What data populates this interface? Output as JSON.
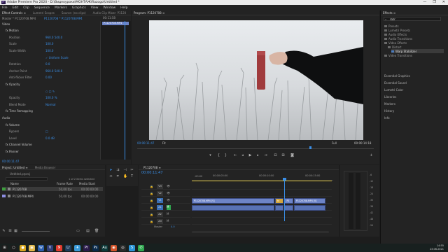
{
  "window": {
    "title": "Adobe Premiere Pro 2020 - D:\\Видеоуроки\\МОНТАЖ\\Razogo\\Untitled *",
    "controls": [
      "—",
      "❐",
      "✕"
    ]
  },
  "menu": [
    "File",
    "Edit",
    "Clip",
    "Sequence",
    "Markers",
    "Graphics",
    "View",
    "Window",
    "Help"
  ],
  "source_tabs": [
    "Effect Controls ≡",
    "Lumetri Scopes",
    "Source: (no clips)",
    "Audio Clip Mixer: P1120"
  ],
  "effect_controls": {
    "source": "Master * P1120708.MP4",
    "sequence": "P1120708 * P1120708.MP4",
    "timecode": "00:11:58",
    "clip": "P1120708.MP4",
    "rows": [
      {
        "label": "Video",
        "val": "",
        "indent": 0
      },
      {
        "label": "fx Motion",
        "val": "",
        "indent": 1
      },
      {
        "label": "Position",
        "val": "960.0    540.0",
        "indent": 2
      },
      {
        "label": "Scale",
        "val": "100.0",
        "indent": 2
      },
      {
        "label": "Scale Width",
        "val": "100.0",
        "indent": 2
      },
      {
        "label": "",
        "val": "✓ Uniform Scale",
        "indent": 2
      },
      {
        "label": "Rotation",
        "val": "0.0",
        "indent": 2
      },
      {
        "label": "Anchor Point",
        "val": "960.0    540.0",
        "indent": 2
      },
      {
        "label": "Anti-flicker Filter",
        "val": "0.00",
        "indent": 2
      },
      {
        "label": "fx Opacity",
        "val": "",
        "indent": 1
      },
      {
        "label": "",
        "val": "○ □ ✎",
        "indent": 2
      },
      {
        "label": "Opacity",
        "val": "100.0 %",
        "indent": 2
      },
      {
        "label": "Blend Mode",
        "val": "Normal",
        "indent": 2
      },
      {
        "label": "fx Time Remapping",
        "val": "",
        "indent": 1
      },
      {
        "label": "Audio",
        "val": "",
        "indent": 0
      },
      {
        "label": "fx Volume",
        "val": "",
        "indent": 1
      },
      {
        "label": "Bypass",
        "val": "□",
        "indent": 2
      },
      {
        "label": "Level",
        "val": "0.0 dB",
        "indent": 2
      },
      {
        "label": "fx Channel Volume",
        "val": "",
        "indent": 1
      },
      {
        "label": "fx Panner",
        "val": "",
        "indent": 1
      }
    ],
    "footer": "00:00:11:47"
  },
  "program": {
    "tab": "Program: P1120708 ≡",
    "timecode": "00:00:11:47",
    "fit": "Fit",
    "quality": "Full",
    "duration": "00:00:14:18"
  },
  "project": {
    "tabs": [
      "Project: Untitled ≡",
      "Media Browser"
    ],
    "name": "Untitled.prproj",
    "count": "1 of 2 items selected",
    "headers": [
      "Name",
      "Frame Rate",
      "Media Start"
    ],
    "items": [
      {
        "name": "P1120708",
        "rate": "50,00 fps",
        "start": "00:00:00:00",
        "color": "#3c9e3c"
      },
      {
        "name": "P1120708.MP4",
        "rate": "50,00 fps",
        "start": "00:00:00:00",
        "color": "#8d8de0"
      }
    ]
  },
  "timeline": {
    "tab": "P1120708 ≡",
    "timecode": "00:00:11:47",
    "ruler": [
      "00:00:05:00",
      "00:00:10:00",
      "00:00:15:00"
    ],
    "ruler_start": ":00:00",
    "video_tracks": [
      "V3",
      "V2",
      "V1"
    ],
    "audio_tracks": [
      "A1",
      "A2",
      "A3"
    ],
    "master": "Master",
    "master_val": "0.0",
    "clip_name": "P1120708.MP4 [V]",
    "clip_short": "P11",
    "clips_v1": [
      {
        "label": "P1120708.MP4 [V]",
        "start": 0.0,
        "end": 0.62
      },
      {
        "label": "fx",
        "start": 0.62,
        "end": 0.69
      },
      {
        "label": "P1",
        "start": 0.69,
        "end": 0.76
      },
      {
        "label": "P1120708.MP4 [V]",
        "start": 0.76,
        "end": 1.0
      }
    ],
    "playhead": 0.69,
    "audio_db": [
      "-6",
      "-12",
      "-18",
      "-24",
      "-30",
      "-36",
      "-42",
      "-48",
      "-54"
    ]
  },
  "effects": {
    "tab": "Effects ≡",
    "search": "razr",
    "tree": [
      {
        "label": "Presets",
        "indent": 0,
        "folder": true
      },
      {
        "label": "Lumetri Presets",
        "indent": 0,
        "folder": true
      },
      {
        "label": "Audio Effects",
        "indent": 0,
        "folder": true
      },
      {
        "label": "Audio Transitions",
        "indent": 0,
        "folder": true
      },
      {
        "label": "Video Effects",
        "indent": 0,
        "folder": true
      },
      {
        "label": "Distort",
        "indent": 1,
        "folder": true
      },
      {
        "label": "Warp Stabilizer",
        "indent": 2,
        "folder": false,
        "selected": true
      },
      {
        "label": "Video Transitions",
        "indent": 0,
        "folder": true
      }
    ],
    "sections": [
      "Essential Graphics",
      "Essential Sound",
      "Lumetri Color",
      "Libraries",
      "Markers",
      "History",
      "Info"
    ]
  },
  "taskbar": {
    "time": "14:55",
    "date": "23.06.2021",
    "icons": [
      {
        "name": "windows-start-icon",
        "glyph": "⊞",
        "color": "#1d1d1d"
      },
      {
        "name": "search-taskbar-icon",
        "glyph": "○",
        "color": "#1d1d1d"
      },
      {
        "name": "chrome-icon",
        "glyph": "●",
        "color": "#d7a520"
      },
      {
        "name": "explorer-icon",
        "glyph": "▣",
        "color": "#e3b84a"
      },
      {
        "name": "word-icon",
        "glyph": "W",
        "color": "#2b5fb0"
      },
      {
        "name": "vegas-icon",
        "glyph": "V",
        "color": "#2f3f7a"
      },
      {
        "name": "yandex-icon",
        "glyph": "Я",
        "color": "#e23b2e"
      },
      {
        "name": "lightroom-icon",
        "glyph": "Lr",
        "color": "#1d3b5a"
      },
      {
        "name": "telegram-icon",
        "glyph": "✈",
        "color": "#3b9bd9"
      },
      {
        "name": "premiere-icon",
        "glyph": "Pr",
        "color": "#2a1a4a"
      },
      {
        "name": "photoshop-icon",
        "glyph": "Ps",
        "color": "#0a2a4a"
      },
      {
        "name": "audition-icon",
        "glyph": "Au",
        "color": "#0d3a3a"
      },
      {
        "name": "firefox-icon",
        "glyph": "◉",
        "color": "#d0532a"
      },
      {
        "name": "cinema-icon",
        "glyph": "◎",
        "color": "#2a2a2a"
      },
      {
        "name": "skype-icon",
        "glyph": "S",
        "color": "#2c95d8"
      },
      {
        "name": "whatsapp-icon",
        "glyph": "✆",
        "color": "#2fa84f"
      }
    ]
  },
  "colors": {
    "accent": "#3a8ee6",
    "clip": "#6d84c7",
    "clip_dark": "#5872b5",
    "green": "#2fa84f"
  }
}
